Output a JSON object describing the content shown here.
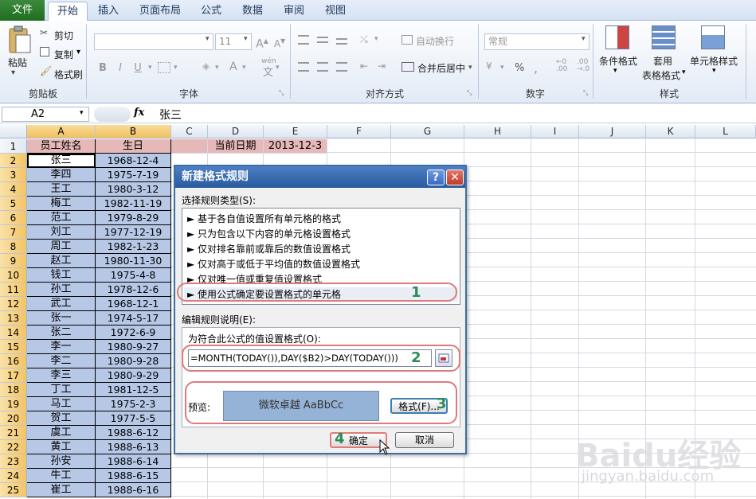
{
  "tabs": [
    "文件",
    "开始",
    "插入",
    "页面布局",
    "公式",
    "数据",
    "审阅",
    "视图"
  ],
  "clipboard": {
    "paste": "粘贴",
    "cut": "剪切",
    "copy": "复制",
    "format_painter": "格式刷",
    "label": "剪贴板"
  },
  "font": {
    "size": "11",
    "label": "字体",
    "bold": "B",
    "italic": "I",
    "underline": "U",
    "wen": "wén"
  },
  "alignment": {
    "wrap": "自动换行",
    "merge": "合并后居中",
    "label": "对齐方式"
  },
  "number": {
    "format": "常规",
    "label": "数字",
    "percent": "%"
  },
  "styles": {
    "conditional": "条件格式",
    "table_format_1": "套用",
    "table_format_2": "表格格式",
    "cell_styles": "单元格样式",
    "label": "样式"
  },
  "formula_bar": {
    "name_box": "A2",
    "fx": "fx",
    "content": "张三"
  },
  "columns": [
    "A",
    "B",
    "C",
    "D",
    "E",
    "F",
    "G",
    "H",
    "I",
    "J",
    "K",
    "L"
  ],
  "header_row": {
    "a": "员工姓名",
    "b": "生日",
    "d": "当前日期",
    "e": "2013-12-3"
  },
  "rows": [
    {
      "n": "1"
    },
    {
      "n": "2",
      "a": "张三",
      "b": "1968-12-4"
    },
    {
      "n": "3",
      "a": "李四",
      "b": "1975-7-19"
    },
    {
      "n": "4",
      "a": "王工",
      "b": "1980-3-12"
    },
    {
      "n": "5",
      "a": "梅工",
      "b": "1982-11-19"
    },
    {
      "n": "6",
      "a": "范工",
      "b": "1979-8-29"
    },
    {
      "n": "7",
      "a": "刘工",
      "b": "1977-12-19"
    },
    {
      "n": "8",
      "a": "周工",
      "b": "1982-1-23"
    },
    {
      "n": "9",
      "a": "赵工",
      "b": "1980-11-30"
    },
    {
      "n": "10",
      "a": "钱工",
      "b": "1975-4-8"
    },
    {
      "n": "11",
      "a": "孙工",
      "b": "1978-12-6"
    },
    {
      "n": "12",
      "a": "武工",
      "b": "1968-12-1"
    },
    {
      "n": "13",
      "a": "张一",
      "b": "1974-5-17"
    },
    {
      "n": "14",
      "a": "张二",
      "b": "1972-6-9"
    },
    {
      "n": "15",
      "a": "李一",
      "b": "1980-9-27"
    },
    {
      "n": "16",
      "a": "李二",
      "b": "1980-9-28"
    },
    {
      "n": "17",
      "a": "李三",
      "b": "1980-9-29"
    },
    {
      "n": "18",
      "a": "丁工",
      "b": "1981-12-5"
    },
    {
      "n": "19",
      "a": "马工",
      "b": "1975-2-3"
    },
    {
      "n": "20",
      "a": "贺工",
      "b": "1977-5-5"
    },
    {
      "n": "21",
      "a": "虞工",
      "b": "1988-6-12"
    },
    {
      "n": "22",
      "a": "黄工",
      "b": "1988-6-13"
    },
    {
      "n": "23",
      "a": "孙安",
      "b": "1988-6-14"
    },
    {
      "n": "24",
      "a": "牛工",
      "b": "1988-6-15"
    },
    {
      "n": "25",
      "a": "崔工",
      "b": "1988-6-16"
    }
  ],
  "dialog": {
    "title": "新建格式规则",
    "help": "?",
    "close": "✕",
    "select_rule_label": "选择规则类型(S):",
    "rule_types": [
      "► 基于各自值设置所有单元格的格式",
      "► 只为包含以下内容的单元格设置格式",
      "► 仅对排名靠前或靠后的数值设置格式",
      "► 仅对高于或低于平均值的数值设置格式",
      "► 仅对唯一值或重复值设置格式",
      "► 使用公式确定要设置格式的单元格"
    ],
    "edit_label": "编辑规则说明(E):",
    "formula_label": "为符合此公式的值设置格式(O):",
    "formula": "=MONTH(TODAY()),DAY($B2)>DAY(TODAY()))",
    "preview_label": "预览:",
    "preview_text": "微软卓越  AaBbCc",
    "format_button": "格式(F)...",
    "ok_button": "确定",
    "cancel_button": "取消",
    "step1": "1",
    "step2": "2",
    "step3": "3",
    "step4": "4"
  },
  "watermark": "Baidu经验",
  "watermark_url": "jingyan.baidu.com"
}
